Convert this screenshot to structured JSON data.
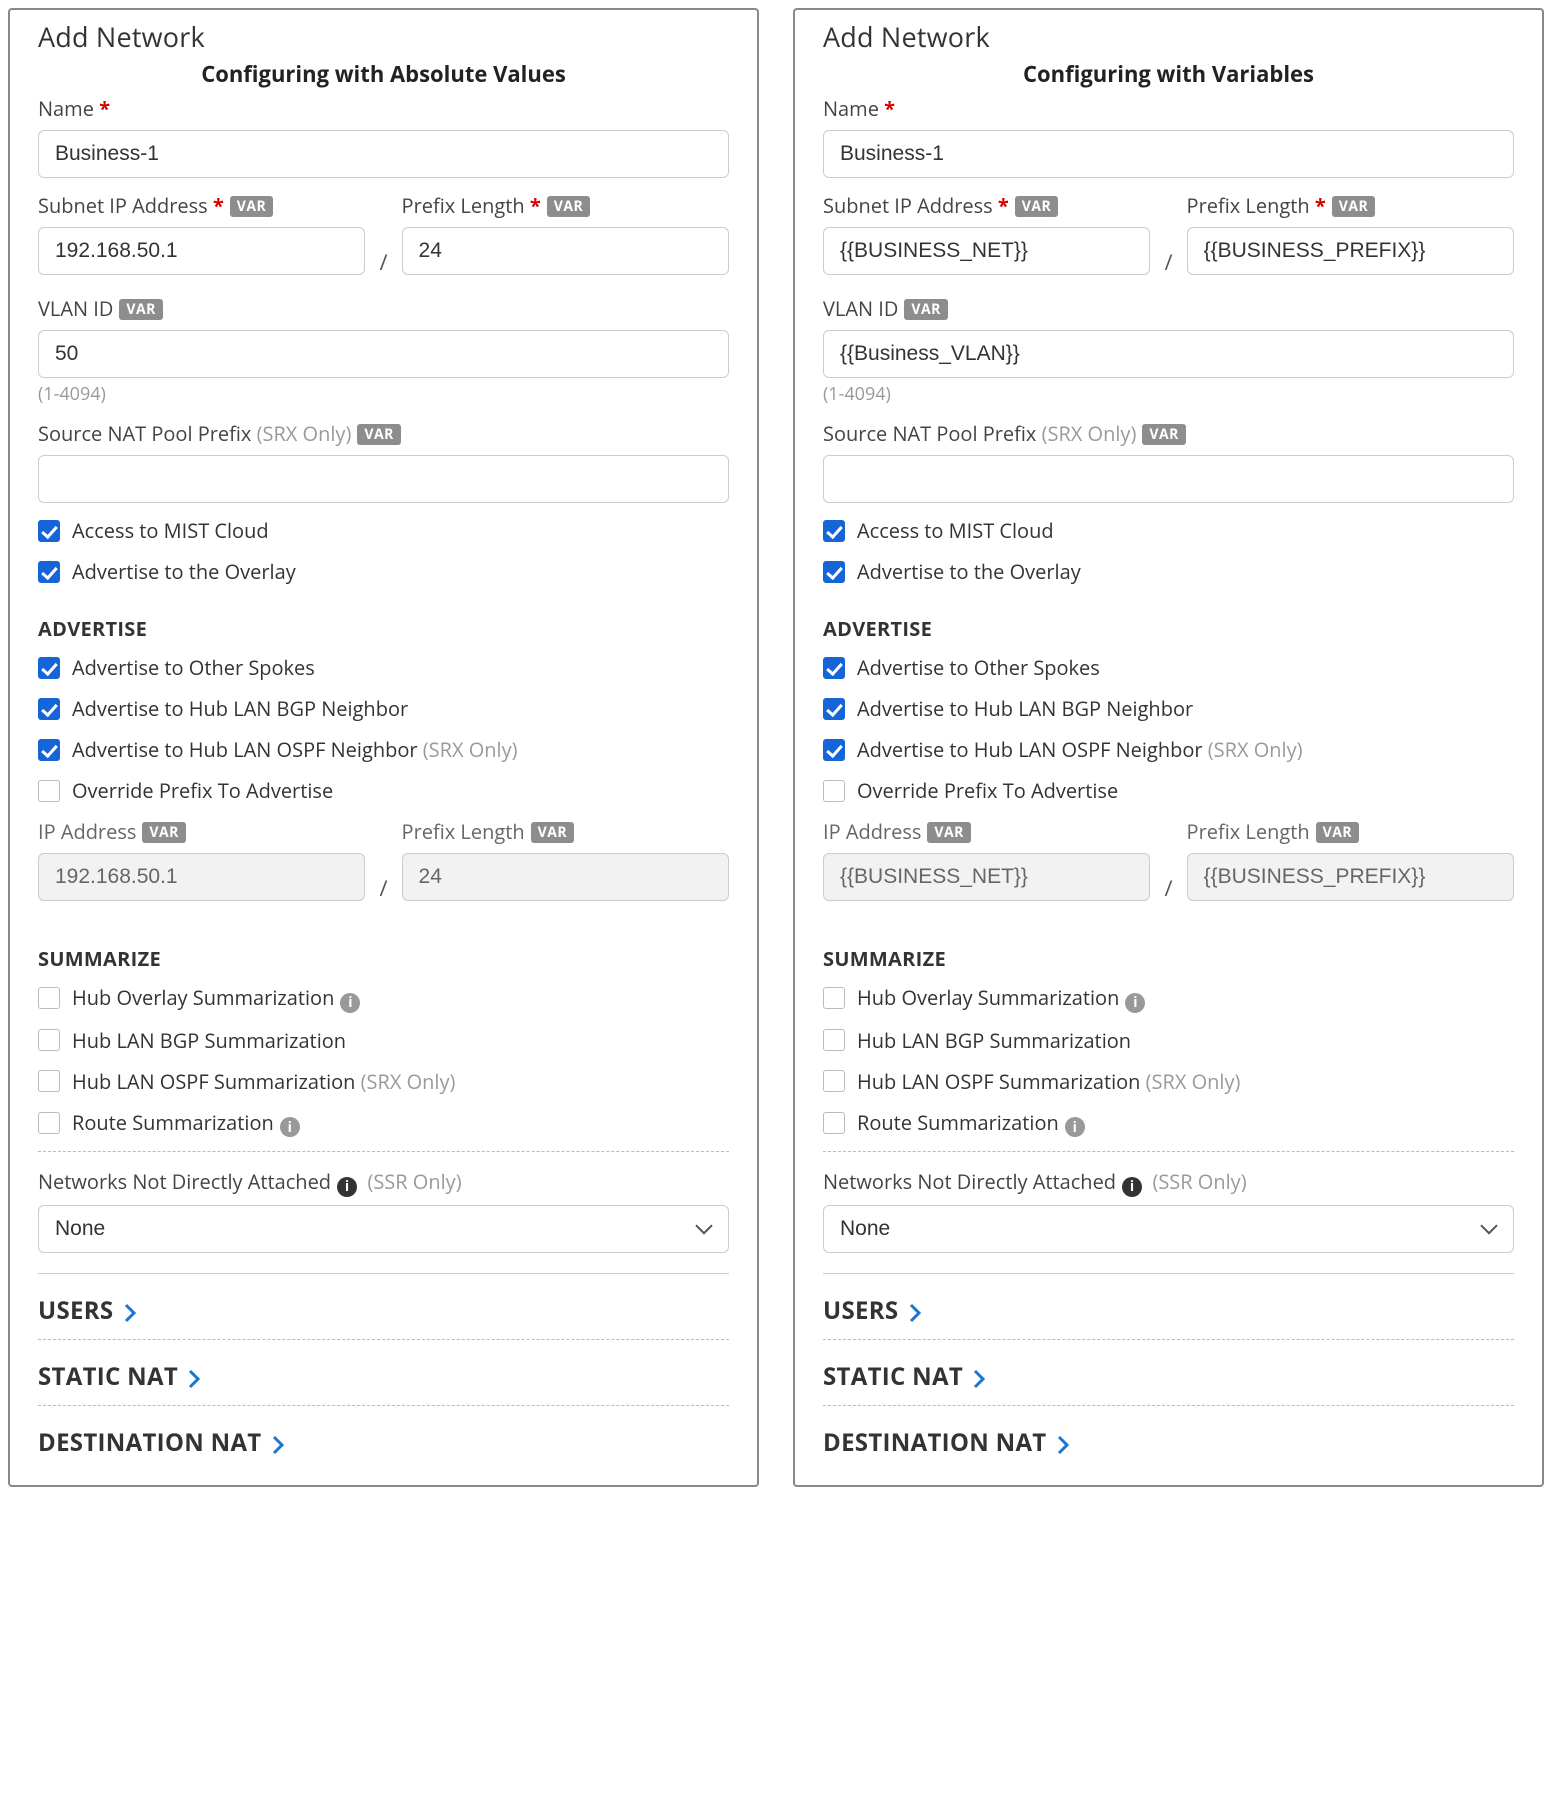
{
  "panels": [
    {
      "title": "Add Network",
      "subtitle": "Configuring with Absolute Values",
      "name_label": "Name",
      "name_value": "Business-1",
      "subnet_label": "Subnet IP Address",
      "subnet_value": "192.168.50.1",
      "prefix_label": "Prefix Length",
      "prefix_value": "24",
      "vlan_label": "VLAN ID",
      "vlan_value": "50",
      "vlan_hint": "(1-4094)",
      "snat_label": "Source NAT Pool Prefix",
      "snat_note": "(SRX Only)",
      "snat_value": "",
      "access_mist": "Access to MIST Cloud",
      "adv_overlay": "Advertise to the Overlay",
      "advertise_head": "ADVERTISE",
      "adv_spokes": "Advertise to Other Spokes",
      "adv_hub_bgp": "Advertise to Hub LAN BGP Neighbor",
      "adv_hub_ospf": "Advertise to Hub LAN OSPF Neighbor",
      "srx_only": "(SRX Only)",
      "override": "Override Prefix To Advertise",
      "ip_label": "IP Address",
      "ip_value": "192.168.50.1",
      "prefix2_label": "Prefix Length",
      "prefix2_value": "24",
      "summarize_head": "SUMMARIZE",
      "sum_overlay": "Hub Overlay Summarization",
      "sum_bgp": "Hub LAN BGP Summarization",
      "sum_ospf": "Hub LAN OSPF Summarization",
      "sum_route": "Route Summarization",
      "nnd_label": "Networks Not Directly Attached",
      "ssr_only": "(SSR Only)",
      "nnd_value": "None",
      "exp_users": "USERS",
      "exp_snat": "STATIC NAT",
      "exp_dnat": "DESTINATION NAT",
      "var": "VAR"
    },
    {
      "title": "Add Network",
      "subtitle": "Configuring with Variables",
      "name_label": "Name",
      "name_value": "Business-1",
      "subnet_label": "Subnet IP Address",
      "subnet_value": "{{BUSINESS_NET}}",
      "prefix_label": "Prefix Length",
      "prefix_value": "{{BUSINESS_PREFIX}}",
      "vlan_label": "VLAN ID",
      "vlan_value": "{{Business_VLAN}}",
      "vlan_hint": "(1-4094)",
      "snat_label": "Source NAT Pool Prefix",
      "snat_note": "(SRX Only)",
      "snat_value": "",
      "access_mist": "Access to MIST Cloud",
      "adv_overlay": "Advertise to the Overlay",
      "advertise_head": "ADVERTISE",
      "adv_spokes": "Advertise to Other Spokes",
      "adv_hub_bgp": "Advertise to Hub LAN BGP Neighbor",
      "adv_hub_ospf": "Advertise to Hub LAN OSPF Neighbor",
      "srx_only": "(SRX Only)",
      "override": "Override Prefix To Advertise",
      "ip_label": "IP Address",
      "ip_value": "{{BUSINESS_NET}}",
      "prefix2_label": "Prefix Length",
      "prefix2_value": "{{BUSINESS_PREFIX}}",
      "summarize_head": "SUMMARIZE",
      "sum_overlay": "Hub Overlay Summarization",
      "sum_bgp": "Hub LAN BGP Summarization",
      "sum_ospf": "Hub LAN OSPF Summarization",
      "sum_route": "Route Summarization",
      "nnd_label": "Networks Not Directly Attached",
      "ssr_only": "(SSR Only)",
      "nnd_value": "None",
      "exp_users": "USERS",
      "exp_snat": "STATIC NAT",
      "exp_dnat": "DESTINATION NAT",
      "var": "VAR"
    }
  ]
}
